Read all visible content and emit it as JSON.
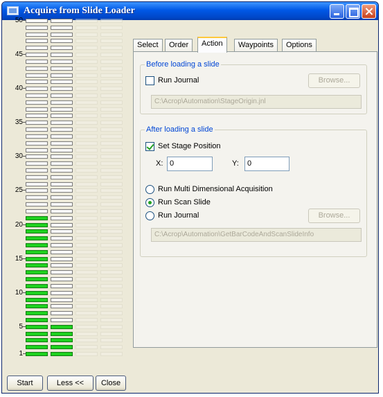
{
  "window": {
    "title": "Acquire from Slide Loader",
    "buttons": [
      "minimize",
      "maximize",
      "close"
    ]
  },
  "rack": {
    "slot_count": 50,
    "axis_labels": [
      "50",
      "45",
      "40",
      "35",
      "30",
      "25",
      "20",
      "15",
      "10",
      "5",
      "1"
    ],
    "loaded_column1_slots": [
      1,
      2,
      3,
      4,
      5,
      6,
      7,
      8,
      9,
      10,
      11,
      12,
      13,
      14,
      15,
      16,
      17,
      18,
      19,
      20,
      21
    ],
    "loaded_column2_slots": [
      1,
      2,
      3,
      4,
      5
    ]
  },
  "bottom_buttons": {
    "start": "Start",
    "less": "Less <<",
    "close": "Close"
  },
  "tabs": [
    {
      "label": "Select",
      "active": false
    },
    {
      "label": "Order",
      "active": false
    },
    {
      "label": "Action",
      "active": true
    },
    {
      "label": "Waypoints",
      "active": false
    },
    {
      "label": "Options",
      "active": false
    }
  ],
  "before_loading": {
    "title": "Before loading a slide",
    "run_journal_label": "Run Journal",
    "run_journal_checked": false,
    "browse_label": "Browse...",
    "path": "C:\\Acrop\\Automation\\StageOrigin.jnl"
  },
  "after_loading": {
    "title": "After loading a slide",
    "set_stage_label": "Set Stage Position",
    "set_stage_checked": true,
    "x_label": "X:",
    "x_value": "0",
    "y_label": "Y:",
    "y_value": "0",
    "options": [
      {
        "label": "Run Multi Dimensional Acquisition",
        "selected": false
      },
      {
        "label": "Run Scan Slide",
        "selected": true
      },
      {
        "label": "Run Journal",
        "selected": false
      }
    ],
    "browse_label": "Browse...",
    "path": "C:\\Acrop\\Automation\\GetBarCodeAndScanSlideInfo"
  },
  "colors": {
    "loaded_slot": "#1fd21f",
    "group_title": "#0046d5",
    "titlebar": "#0058e6"
  }
}
